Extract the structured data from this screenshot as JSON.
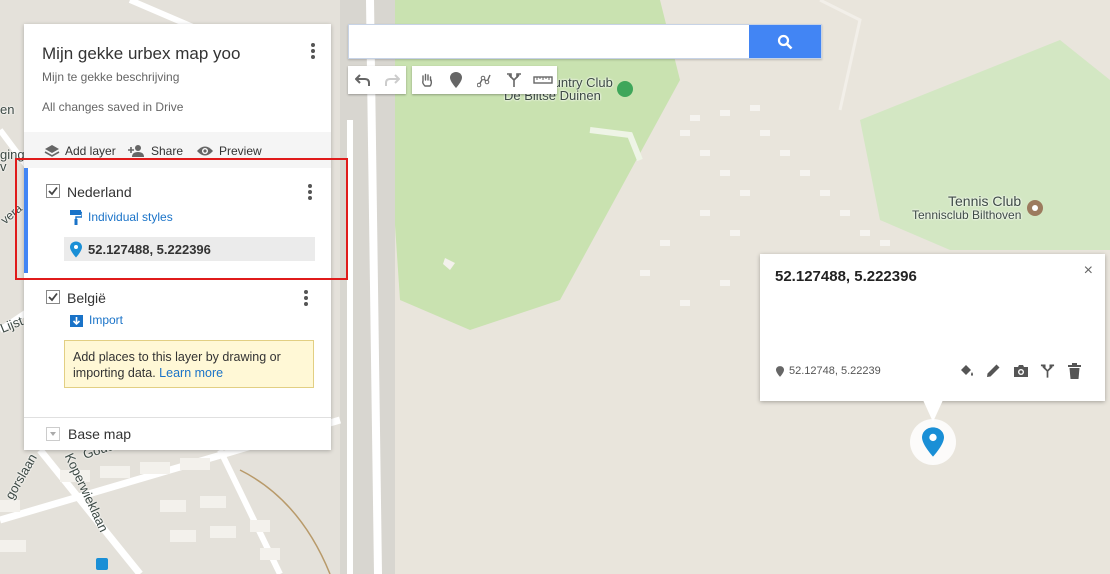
{
  "search": {
    "placeholder": "",
    "value": ""
  },
  "toolbar": {
    "undo_icon": "undo-icon",
    "redo_icon": "redo-icon",
    "pan_icon": "hand-icon",
    "marker_icon": "add-marker-icon",
    "line_icon": "draw-line-icon",
    "directions_icon": "directions-icon",
    "measure_icon": "ruler-icon"
  },
  "map_labels": {
    "club_line1": "Country Club",
    "club_prefix": "e",
    "club_line2": "De Biltse Duinen",
    "tennis_line1": "Tennis Club",
    "tennis_line2": "Tennisclub Bilthoven",
    "edge_en": "en",
    "edge_ging": "ging",
    "edge_v": "v",
    "edge_lijst": "Lijst",
    "edge_goud": "Goudhaa",
    "edge_koper": "Koperwieklaan",
    "edge_gorslaan": "gorslaan",
    "edge_vera": "vera"
  },
  "panel": {
    "title": "Mijn gekke urbex map yoo",
    "description": "Mijn te gekke beschrijving",
    "save_status": "All changes saved in Drive",
    "actions": {
      "add_layer": "Add layer",
      "share": "Share",
      "preview": "Preview"
    },
    "layers": [
      {
        "name": "Nederland",
        "checked": true,
        "style_link": "Individual styles",
        "features": [
          "52.127488, 5.222396"
        ]
      },
      {
        "name": "België",
        "checked": true,
        "import_link": "Import",
        "tip_text": "Add places to this layer by drawing or importing data.",
        "tip_link": "Learn more"
      }
    ],
    "base_map": "Base map"
  },
  "popup": {
    "title": "52.127488, 5.222396",
    "coords": "52.12748, 5.22239",
    "close": "×"
  },
  "colors": {
    "accent": "#4285f4",
    "highlight": "#e01b1b",
    "marker": "#1a8fd6",
    "park": "#c9e2b0",
    "road": "#ffffff"
  }
}
